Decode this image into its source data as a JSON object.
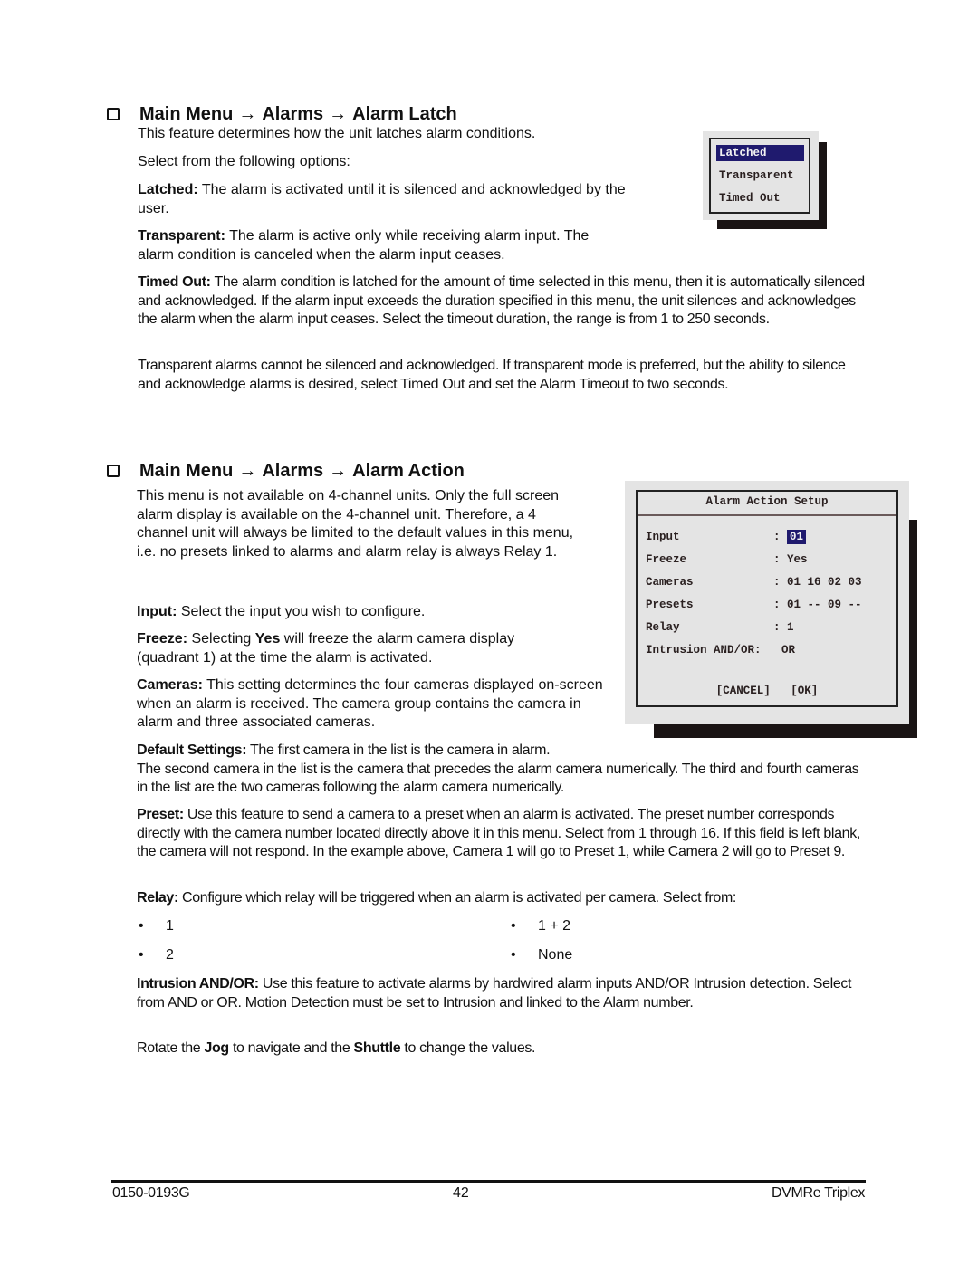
{
  "section_latch": {
    "heading": {
      "part1": "Main Menu",
      "part2": "Alarms",
      "part3": "Alarm Latch",
      "arrow": "→"
    },
    "intro": "This feature determines how the unit latches alarm conditions.",
    "select_prompt": "Select from the following options:",
    "latched": {
      "label": "Latched:",
      "text": " The alarm is activated until it is silenced and acknowledged by the user."
    },
    "transparent": {
      "label": "Transparent:",
      "text": " The alarm is active only while receiving alarm input. The alarm condition is canceled when the alarm input ceases."
    },
    "timed_out": {
      "label": "Timed Out:",
      "text": " The alarm condition is latched for the amount of time selected in this menu, then it is automatically silenced and acknowledged.  If the alarm input exceeds the duration specified in this menu, the unit silences and acknowledges the alarm when the alarm input ceases.  Select the timeout duration, the range is from 1 to 250 seconds."
    },
    "note": "Transparent alarms cannot be silenced and acknowledged.  If transparent mode is preferred, but the ability to silence and acknowledge alarms is desired, select Timed Out and set the Alarm Timeout to two seconds.",
    "menu": {
      "options": [
        "Latched",
        "Transparent",
        "Timed Out"
      ],
      "selected": "Latched"
    }
  },
  "section_action": {
    "heading": {
      "part1": "Main Menu",
      "part2": "Alarms",
      "part3": "Alarm Action",
      "arrow": "→"
    },
    "intro": "This menu is not available on 4-channel units.  Only the full screen alarm display is available on the 4-channel unit. Therefore, a 4 channel unit will always be limited to the default values in this menu, i.e. no presets linked to alarms and alarm relay is always Relay 1.",
    "input": {
      "label": "Input:",
      "text": " Select the input you wish to configure."
    },
    "freeze": {
      "label": "Freeze:",
      "text1": " Selecting ",
      "bold": "Yes",
      "text2": " will freeze the alarm camera display (quadrant 1) at the time the alarm is activated."
    },
    "cameras": {
      "label": "Cameras:",
      "text": " This setting determines the four cameras displayed on-screen when an alarm is received.  The camera group contains the camera in alarm and three associated cameras."
    },
    "defaults": {
      "label": "Default Settings:",
      "text": " The first camera in the list is the camera in alarm.",
      "text2": "The second camera in the list is the camera that precedes the alarm camera numerically.  The third and fourth cameras in the list are the two cameras following the alarm camera numerically."
    },
    "preset": {
      "label": "Preset:",
      "text": " Use this feature to send a camera to a preset when an alarm is activated.  The preset number corresponds directly with the camera number located directly above it in this menu.  Select from 1 through 16.  If this field is left blank, the camera will not respond.  In the example above, Camera 1 will go to Preset 1, while Camera 2 will go to Preset 9."
    },
    "relay": {
      "label": "Relay:",
      "text": " Configure which relay will be triggered when an alarm is activated per camera. Select from:"
    },
    "relay_options": [
      "1",
      "2",
      "1 + 2",
      "None"
    ],
    "bullet_char": "•",
    "intrusion": {
      "label": "Intrusion AND/OR:",
      "text": " Use this feature to activate alarms by hardwired alarm inputs AND/OR Intrusion detection. Select from AND or OR. Motion Detection must be set to Intrusion and linked to the Alarm number."
    },
    "rotate": {
      "t1": "Rotate the ",
      "jog": "Jog",
      "t2": " to navigate and the ",
      "shuttle": "Shuttle",
      "t3": " to change the values."
    },
    "menu": {
      "title": "Alarm Action Setup",
      "rows": [
        {
          "label": "Input",
          "value": "01"
        },
        {
          "label": "Freeze",
          "value": "Yes"
        },
        {
          "label": "Cameras",
          "value": "01 16 02 03"
        },
        {
          "label": "Presets",
          "value": "01 -- 09 --"
        },
        {
          "label": "Relay",
          "value": "1"
        },
        {
          "label": "Intrusion AND/OR",
          "value": "OR"
        }
      ],
      "separator": ":",
      "cancel": "[CANCEL]",
      "ok": "[OK]"
    }
  },
  "footer": {
    "doc_number": "0150-0193G",
    "page": "42",
    "product": "DVMRe Triplex"
  }
}
